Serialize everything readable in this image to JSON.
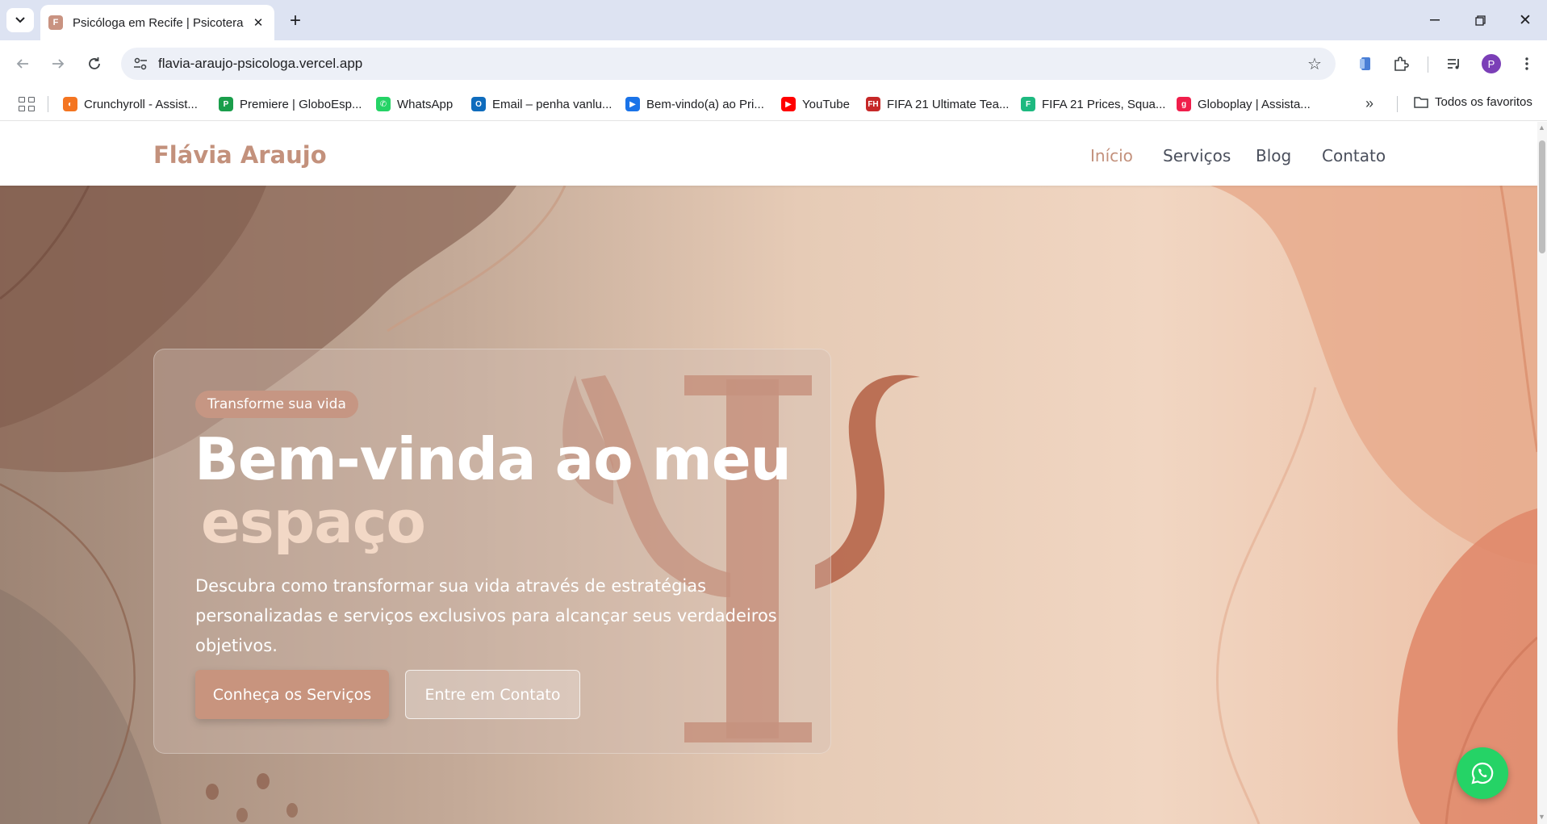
{
  "browser": {
    "tab_title": "Psicóloga em Recife | Psicoterap",
    "tab_favicon_letter": "F",
    "url": "flavia-araujo-psicologa.vercel.app",
    "avatar_letter": "P",
    "bookmarks": [
      {
        "label": "Crunchyroll - Assist...",
        "color": "#f47521",
        "glyph": "◐"
      },
      {
        "label": "Premiere | GloboEsp...",
        "color": "#1a9e4b",
        "glyph": "P"
      },
      {
        "label": "WhatsApp",
        "color": "#25d366",
        "glyph": "✆"
      },
      {
        "label": "Email – penha vanlu...",
        "color": "#0f6cbd",
        "glyph": "O"
      },
      {
        "label": "Bem-vindo(a) ao Pri...",
        "color": "#1a73e8",
        "glyph": "▶"
      },
      {
        "label": "YouTube",
        "color": "#ff0000",
        "glyph": "▶"
      },
      {
        "label": "FIFA 21 Ultimate Tea...",
        "color": "#c62828",
        "glyph": "FH"
      },
      {
        "label": "FIFA 21 Prices, Squa...",
        "color": "#1eb980",
        "glyph": "F"
      },
      {
        "label": "Globoplay | Assista...",
        "color": "#f01e4b",
        "glyph": "g"
      }
    ],
    "all_bookmarks_label": "Todos os favoritos"
  },
  "site": {
    "brand": "Flávia Araujo",
    "nav": [
      "Início",
      "Serviços",
      "Blog",
      "Contato"
    ],
    "active_nav": "Início"
  },
  "hero": {
    "badge": "Transforme sua vida",
    "headline": "Bem-vinda ao meu",
    "headline_accent": "espaço",
    "lead": "Descubra como transformar sua vida através de estratégias personalizadas e serviços exclusivos para alcançar seus verdadeiros objetivos.",
    "primary_button": "Conheça os Serviços",
    "secondary_button": "Entre em Contato",
    "symbol": "Ψ"
  },
  "colors": {
    "brand": "#c3917c",
    "whatsapp": "#25d366"
  }
}
